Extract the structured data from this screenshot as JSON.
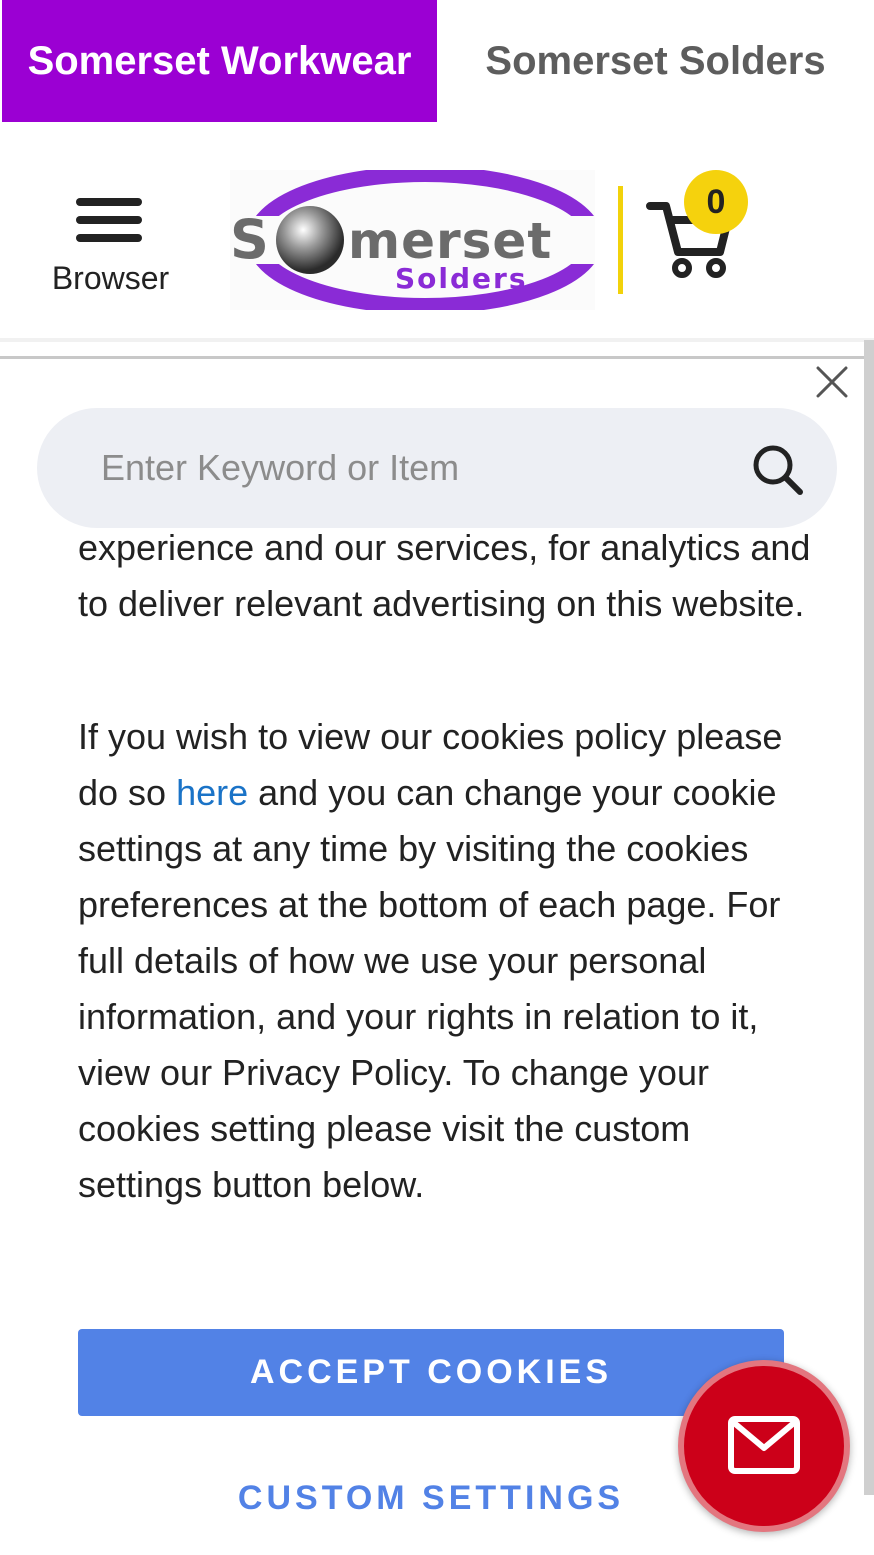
{
  "tabs": {
    "active": "Somerset Workwear",
    "inactive": "Somerset Solders"
  },
  "header": {
    "menu_label": "Browser",
    "logo_text_main": "Somerset",
    "logo_text_sub": "Solders",
    "cart_count": "0"
  },
  "search": {
    "placeholder": "Enter Keyword or Item"
  },
  "cookie": {
    "p1": "experience and our services, for analytics and to deliver relevant advertising on this website.",
    "p2_before": "If you wish to view our cookies policy please do so ",
    "p2_link": "here",
    "p2_after": " and you can change your cookie settings at any time by visiting the cookies preferences at the bottom of each page. For full details of how we use your personal information, and your rights in relation to it, view our Privacy Policy. To change your cookies setting please visit the custom settings button below.",
    "accept_label": "ACCEPT COOKIES",
    "custom_label": "CUSTOM SETTINGS"
  },
  "colors": {
    "brand_purple": "#9b00d3",
    "accent_blue": "#5282e6",
    "badge_yellow": "#f5d20d",
    "mail_red": "#cc0019"
  },
  "icons": [
    "hamburger-icon",
    "cart-icon",
    "close-icon",
    "search-icon",
    "mail-icon"
  ]
}
